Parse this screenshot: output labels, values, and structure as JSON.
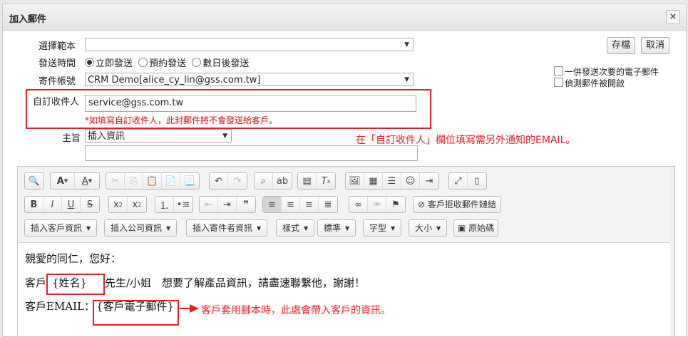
{
  "dialog": {
    "title": "加入郵件",
    "close_label": "×"
  },
  "form": {
    "template_label": "選擇範本",
    "template_value": "",
    "send_time_label": "發送時間",
    "send_options": [
      "立即發送",
      "預約發送",
      "數日後發送"
    ],
    "account_label": "寄件帳號",
    "account_value": "CRM Demo[alice_cy_lin@gss.com.tw]",
    "custom_recipient_label": "自訂收件人",
    "custom_recipient_value": "service@gss.com.tw",
    "custom_recipient_note": "*如填寫自訂收件人，此封郵件將不會發送給客戶。",
    "subject_label": "主旨",
    "insert_info_value": "插入資訊",
    "subject_value": ""
  },
  "actions": {
    "save_label": "存檔",
    "cancel_label": "取消"
  },
  "options": {
    "combine_label": "一併發送次要的電子郵件",
    "track_label": "偵測郵件被開啟"
  },
  "annotations": {
    "recipient_tip": "在「自訂收件人」欄位填寫需另外通知的EMAIL。",
    "script_tip": "客戶套用腳本時，此處會帶入客戶的資訊。"
  },
  "toolbar": {
    "reject_link_label": "客戶拒收郵件鏈結",
    "dropdowns": [
      "插入客戶資訊",
      "插入公司資訊",
      "插入寄件者資訊",
      "樣式",
      "標準",
      "字型",
      "大小"
    ],
    "source_label": "原始碼"
  },
  "content": {
    "greeting": "親愛的同仁，您好：",
    "line2_prefix": "客戶",
    "name_placeholder": "{姓名}",
    "line2_suffix": "先生/小姐　想要了解產品資訊，請盡速聯繫他，謝謝！",
    "line3_prefix": "客戶EMAIL：",
    "email_placeholder": "{客戶電子郵件}"
  },
  "colors": {
    "annotation_red": "#e0202a",
    "note_red": "#d0121b"
  }
}
